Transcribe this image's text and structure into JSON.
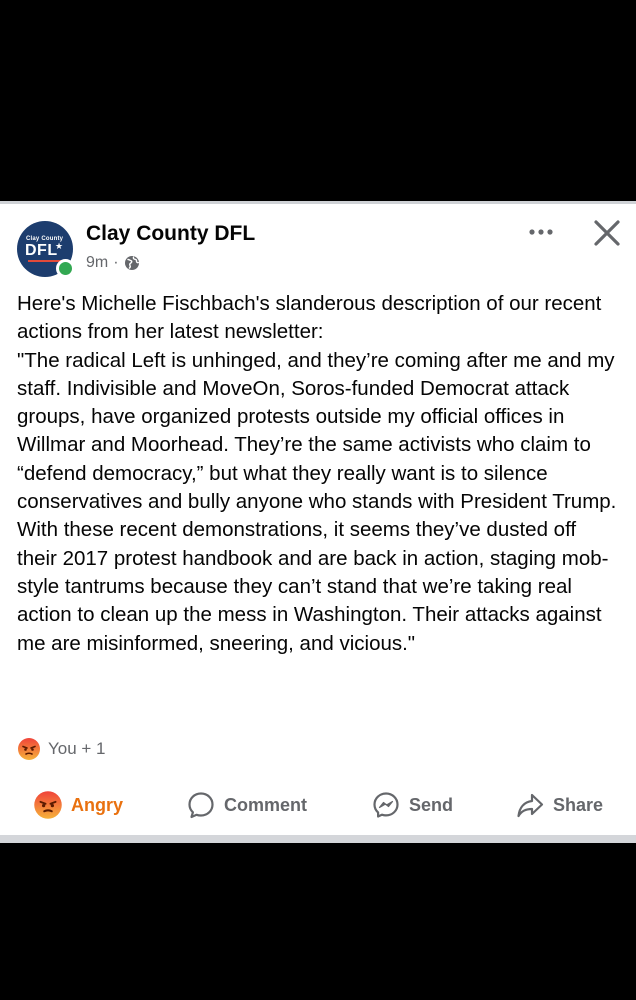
{
  "post": {
    "page_name": "Clay County DFL",
    "time": "9m",
    "separator": "·",
    "privacy_icon": "globe-icon",
    "avatar": {
      "small_text": "Clay County",
      "big_text": "DFL",
      "online_color": "#33a852"
    },
    "text": "Here's Michelle Fischbach's slanderous description of our recent actions from her latest newsletter:\n\"The radical Left is unhinged, and they’re coming after me and my staff. Indivisible and MoveOn, Soros-funded Democrat attack groups, have organized protests outside my official offices in Willmar and Moorhead. They’re the same activists who claim to “defend democracy,” but what they really want is to silence conservatives and bully anyone who stands with President Trump. With these recent demonstrations, it seems they’ve dusted off their 2017 protest handbook and are back in action, staging mob-style tantrums because they can’t stand that we’re taking real action to clean up the mess in Washington. Their attacks against me are misinformed, sneering, and vicious.\""
  },
  "reactions": {
    "icon": "angry-emoji-icon",
    "summary": "You + 1"
  },
  "actions": {
    "angry": "Angry",
    "comment": "Comment",
    "send": "Send",
    "share": "Share"
  },
  "colors": {
    "angry_accent": "#e9710f",
    "secondary_text": "#65676b",
    "primary_text": "#050505"
  }
}
